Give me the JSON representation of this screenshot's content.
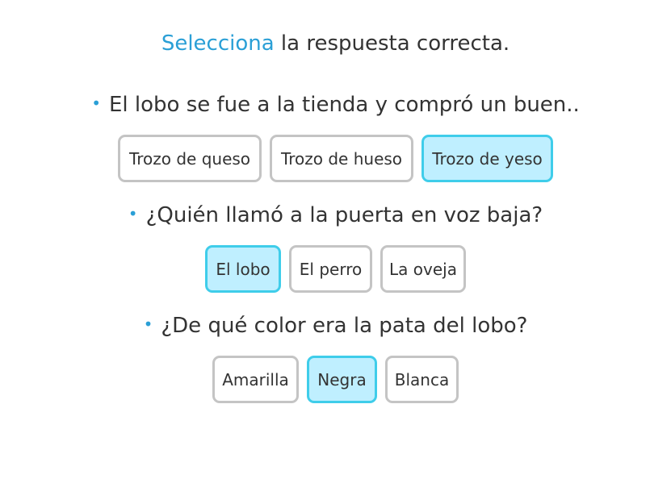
{
  "instruction": {
    "highlight": "Selecciona",
    "rest": " la respuesta correcta."
  },
  "bullet_glyph": "•",
  "colors": {
    "accent": "#2a9fd6",
    "selected_border": "#3fcdea",
    "selected_fill": "#bfefff",
    "default_border": "#c4c4c4"
  },
  "questions": [
    {
      "text": "El lobo se fue a la tienda y compró un buen..",
      "options": [
        "Trozo de queso",
        "Trozo de hueso",
        "Trozo de yeso"
      ],
      "selected": "Trozo de yeso"
    },
    {
      "text": "¿Quién llamó a la puerta en voz baja?",
      "options": [
        "El lobo",
        "El perro",
        "La oveja"
      ],
      "selected": "El lobo"
    },
    {
      "text": "¿De qué color era la pata del lobo?",
      "options": [
        "Amarilla",
        "Negra",
        "Blanca"
      ],
      "selected": "Negra"
    }
  ]
}
